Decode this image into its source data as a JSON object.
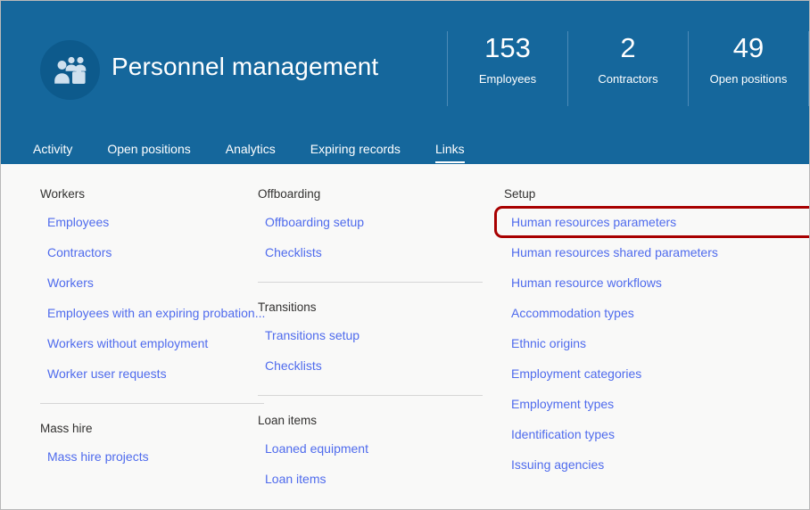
{
  "header": {
    "title": "Personnel management",
    "avatar_icon": "people-briefcase-icon",
    "brand_color": "#15679c",
    "metrics": [
      {
        "value": "153",
        "label": "Employees"
      },
      {
        "value": "2",
        "label": "Contractors"
      },
      {
        "value": "49",
        "label": "Open positions"
      }
    ],
    "tabs": [
      {
        "label": "Activity",
        "active": false
      },
      {
        "label": "Open positions",
        "active": false
      },
      {
        "label": "Analytics",
        "active": false
      },
      {
        "label": "Expiring records",
        "active": false
      },
      {
        "label": "Links",
        "active": true
      }
    ]
  },
  "highlight": {
    "color": "#a80000",
    "target": "Human resources parameters"
  },
  "columns": [
    {
      "groups": [
        {
          "title": "Workers",
          "links": [
            "Employees",
            "Contractors",
            "Workers",
            "Employees with an expiring probation...",
            "Workers without employment",
            "Worker user requests"
          ]
        },
        {
          "title": "Mass hire",
          "links": [
            "Mass hire projects"
          ]
        }
      ]
    },
    {
      "groups": [
        {
          "title": "Offboarding",
          "links": [
            "Offboarding setup",
            "Checklists"
          ]
        },
        {
          "title": "Transitions",
          "links": [
            "Transitions setup",
            "Checklists"
          ]
        },
        {
          "title": "Loan items",
          "links": [
            "Loaned equipment",
            "Loan items"
          ]
        }
      ]
    },
    {
      "groups": [
        {
          "title": "Setup",
          "links": [
            "Human resources parameters",
            "Human resources shared parameters",
            "Human resource workflows",
            "Accommodation types",
            "Ethnic origins",
            "Employment categories",
            "Employment types",
            "Identification types",
            "Issuing agencies"
          ]
        }
      ]
    }
  ]
}
